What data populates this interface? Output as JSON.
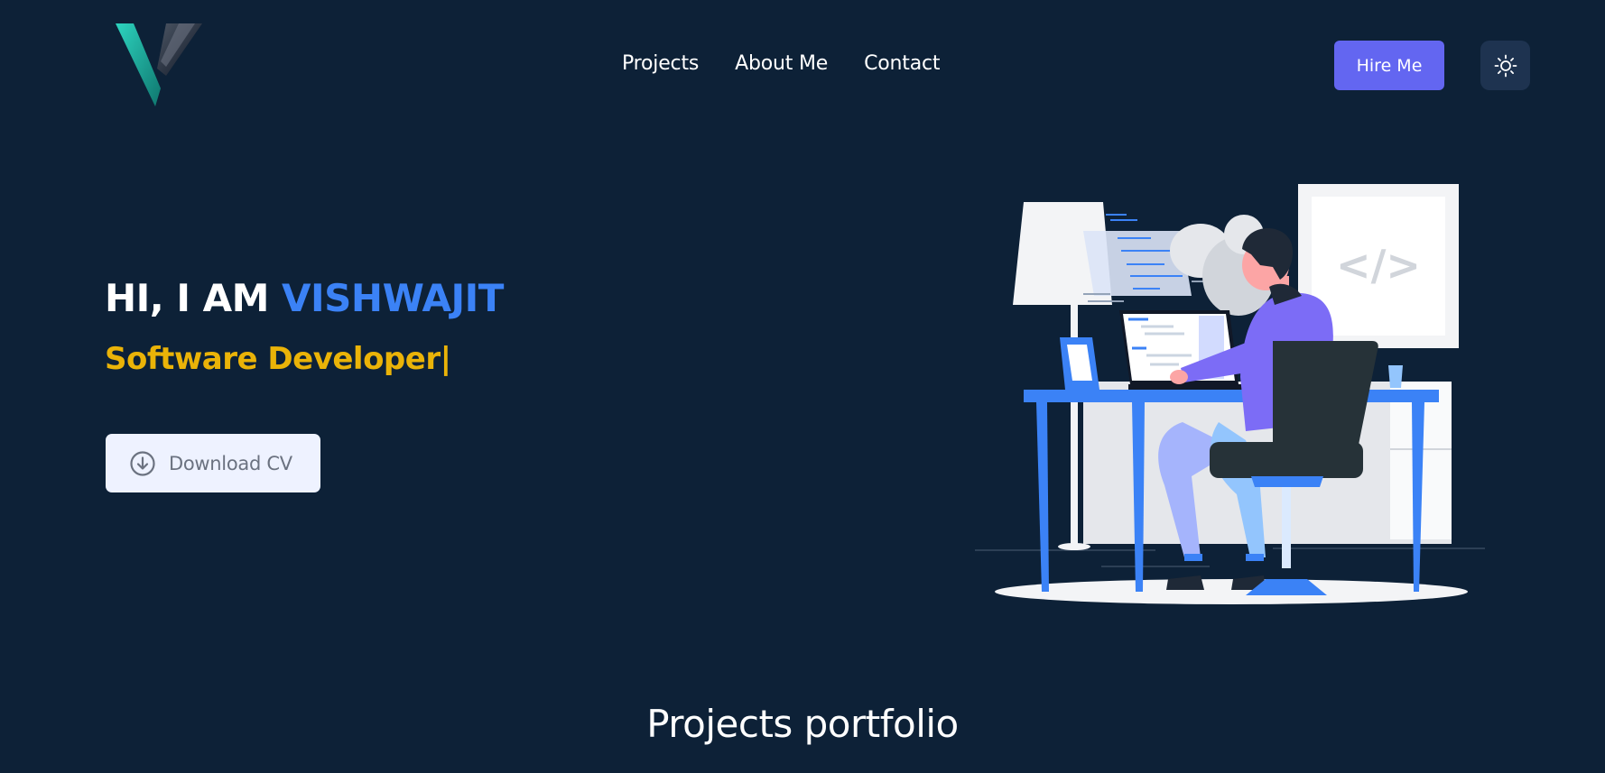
{
  "header": {
    "nav": [
      {
        "label": "Projects"
      },
      {
        "label": "About Me"
      },
      {
        "label": "Contact"
      }
    ],
    "hire_label": "Hire Me",
    "theme_icon": "sun-icon"
  },
  "hero": {
    "greeting": "HI, I AM ",
    "name": "VISHWAJIT",
    "role": "Software Developer|",
    "cv_label": "Download CV",
    "cv_icon": "download-circle-icon",
    "illustration_code_glyph": "</>"
  },
  "sections": {
    "projects_title": "Projects portfolio"
  },
  "colors": {
    "background": "#0d2137",
    "accent_blue": "#3b82f6",
    "role_yellow": "#eab308",
    "hire_purple": "#6366f1"
  }
}
